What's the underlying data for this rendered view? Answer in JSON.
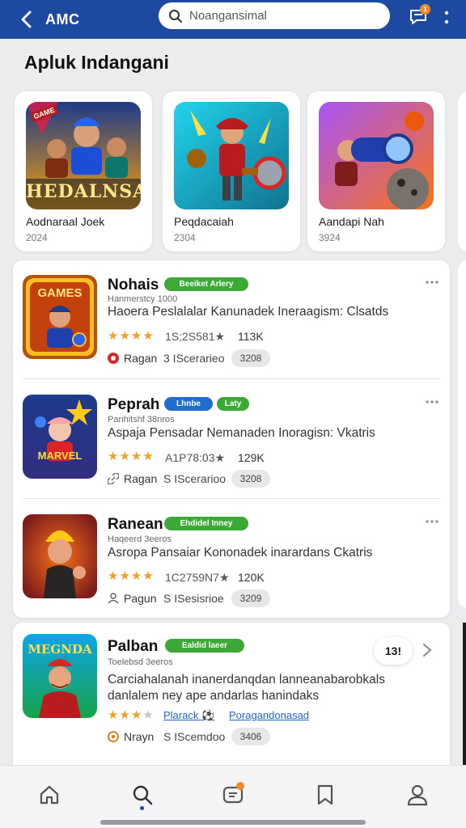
{
  "header": {
    "brand": "AMC",
    "search_placeholder": "Noangansimal",
    "notification_count": "1"
  },
  "section_title": "Apluk Indangani",
  "featured": [
    {
      "name": "Aodnaraal Joek",
      "year": "2024",
      "art_text": "HEDALNSAI",
      "art_badge": "GAME"
    },
    {
      "name": "Peqdacaiah",
      "year": "2304"
    },
    {
      "name": "Aandapi Nah",
      "year": "3924"
    }
  ],
  "list": [
    {
      "title": "Nohais",
      "tag": "Beeiket Arlery",
      "subtitle": "Hanmerstcy 1000",
      "desc": "Haoera Peslalalar Kanunadek Ineraagism: Clsatds",
      "stars": 4,
      "score": "1S;2S581★",
      "count": "113K",
      "dev": "Ragan",
      "category": "3 IScerarieo",
      "pill": "3208",
      "art_text": "GAMES"
    },
    {
      "title": "Peprah",
      "tag": "Lhnbe",
      "tag2": "Laty",
      "subtitle": "Panhitshf 38nros",
      "desc": "Aspaja Pensadar Nemanaden Inoragisn: Vkatris",
      "stars": 4,
      "score": "A1P78:03★",
      "count": "129K",
      "dev": "Ragan",
      "category": "S IScerarioo",
      "pill": "3208",
      "art_text": "MARVEL"
    },
    {
      "title": "Ranean",
      "tag": "Ehdidel Inney",
      "subtitle": "Haqeerd 3eeros",
      "desc": "Asropa Pansaiar Kononadek inarardans Ckatris",
      "stars": 4,
      "score": "1C2759N7★",
      "count": "120K",
      "dev": "Pagun",
      "category": "S ISesisrioe",
      "pill": "3209"
    },
    {
      "title": "Palban",
      "tag": "Ealdid laeer",
      "subtitle": "Toelebsd 3eeros",
      "desc_line1": "Carciahalanah inanerdanqdan lanneanabarobkals",
      "desc_line2": "danlalem ney ape andarlas hanindaks",
      "stars": 3,
      "link1": "Plarack ⚽",
      "link2": "Poragandonasad",
      "dev": "Nrayn",
      "category": "S IScemdoo",
      "pill": "3406",
      "bubble": "13!",
      "art_text": "MEGNDA"
    }
  ],
  "colors": {
    "header": "#1d49a0",
    "accent_green": "#3aa935",
    "accent_blue": "#1f6dd1",
    "star": "#f0a020",
    "badge": "#f08a2c"
  },
  "icons": {
    "header": [
      "back-arrow-icon",
      "search-icon",
      "chat-notification-icon",
      "more-vertical-icon"
    ],
    "nav": [
      "home-icon",
      "search-icon",
      "messages-icon",
      "bookmark-icon",
      "profile-icon"
    ]
  }
}
